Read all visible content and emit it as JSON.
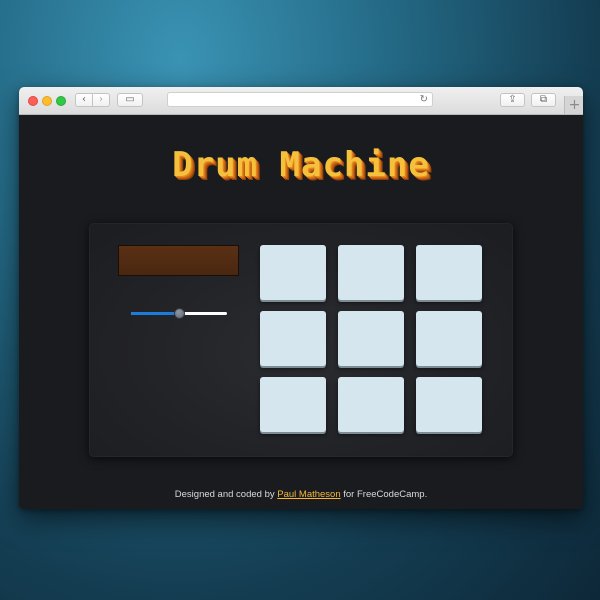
{
  "window": {
    "nav_back": "‹",
    "nav_forward": "›",
    "sidebar_glyph": "▭",
    "reload_glyph": "↻",
    "share_glyph": "⇪",
    "tabs_glyph": "⧉",
    "new_tab_glyph": "+",
    "address_value": ""
  },
  "app": {
    "title": "Drum Machine",
    "display_text": "",
    "volume": 0.5,
    "pads": [
      {
        "key": ""
      },
      {
        "key": ""
      },
      {
        "key": ""
      },
      {
        "key": ""
      },
      {
        "key": ""
      },
      {
        "key": ""
      },
      {
        "key": ""
      },
      {
        "key": ""
      },
      {
        "key": ""
      }
    ]
  },
  "footer": {
    "prefix": "Designed and coded by ",
    "author": "Paul Matheson",
    "suffix": " for FreeCodeCamp."
  },
  "colors": {
    "title": "#f5c13d",
    "pad": "#d6e6ef",
    "display": "#5a3015",
    "slider_fill": "#1b7ce0",
    "link": "#f4b73a",
    "page_bg": "#1a1b1f"
  },
  "icons": [
    "traffic-lights",
    "back-icon",
    "forward-icon",
    "sidebar-icon",
    "reload-icon",
    "share-icon",
    "tabs-icon",
    "plus-icon"
  ]
}
